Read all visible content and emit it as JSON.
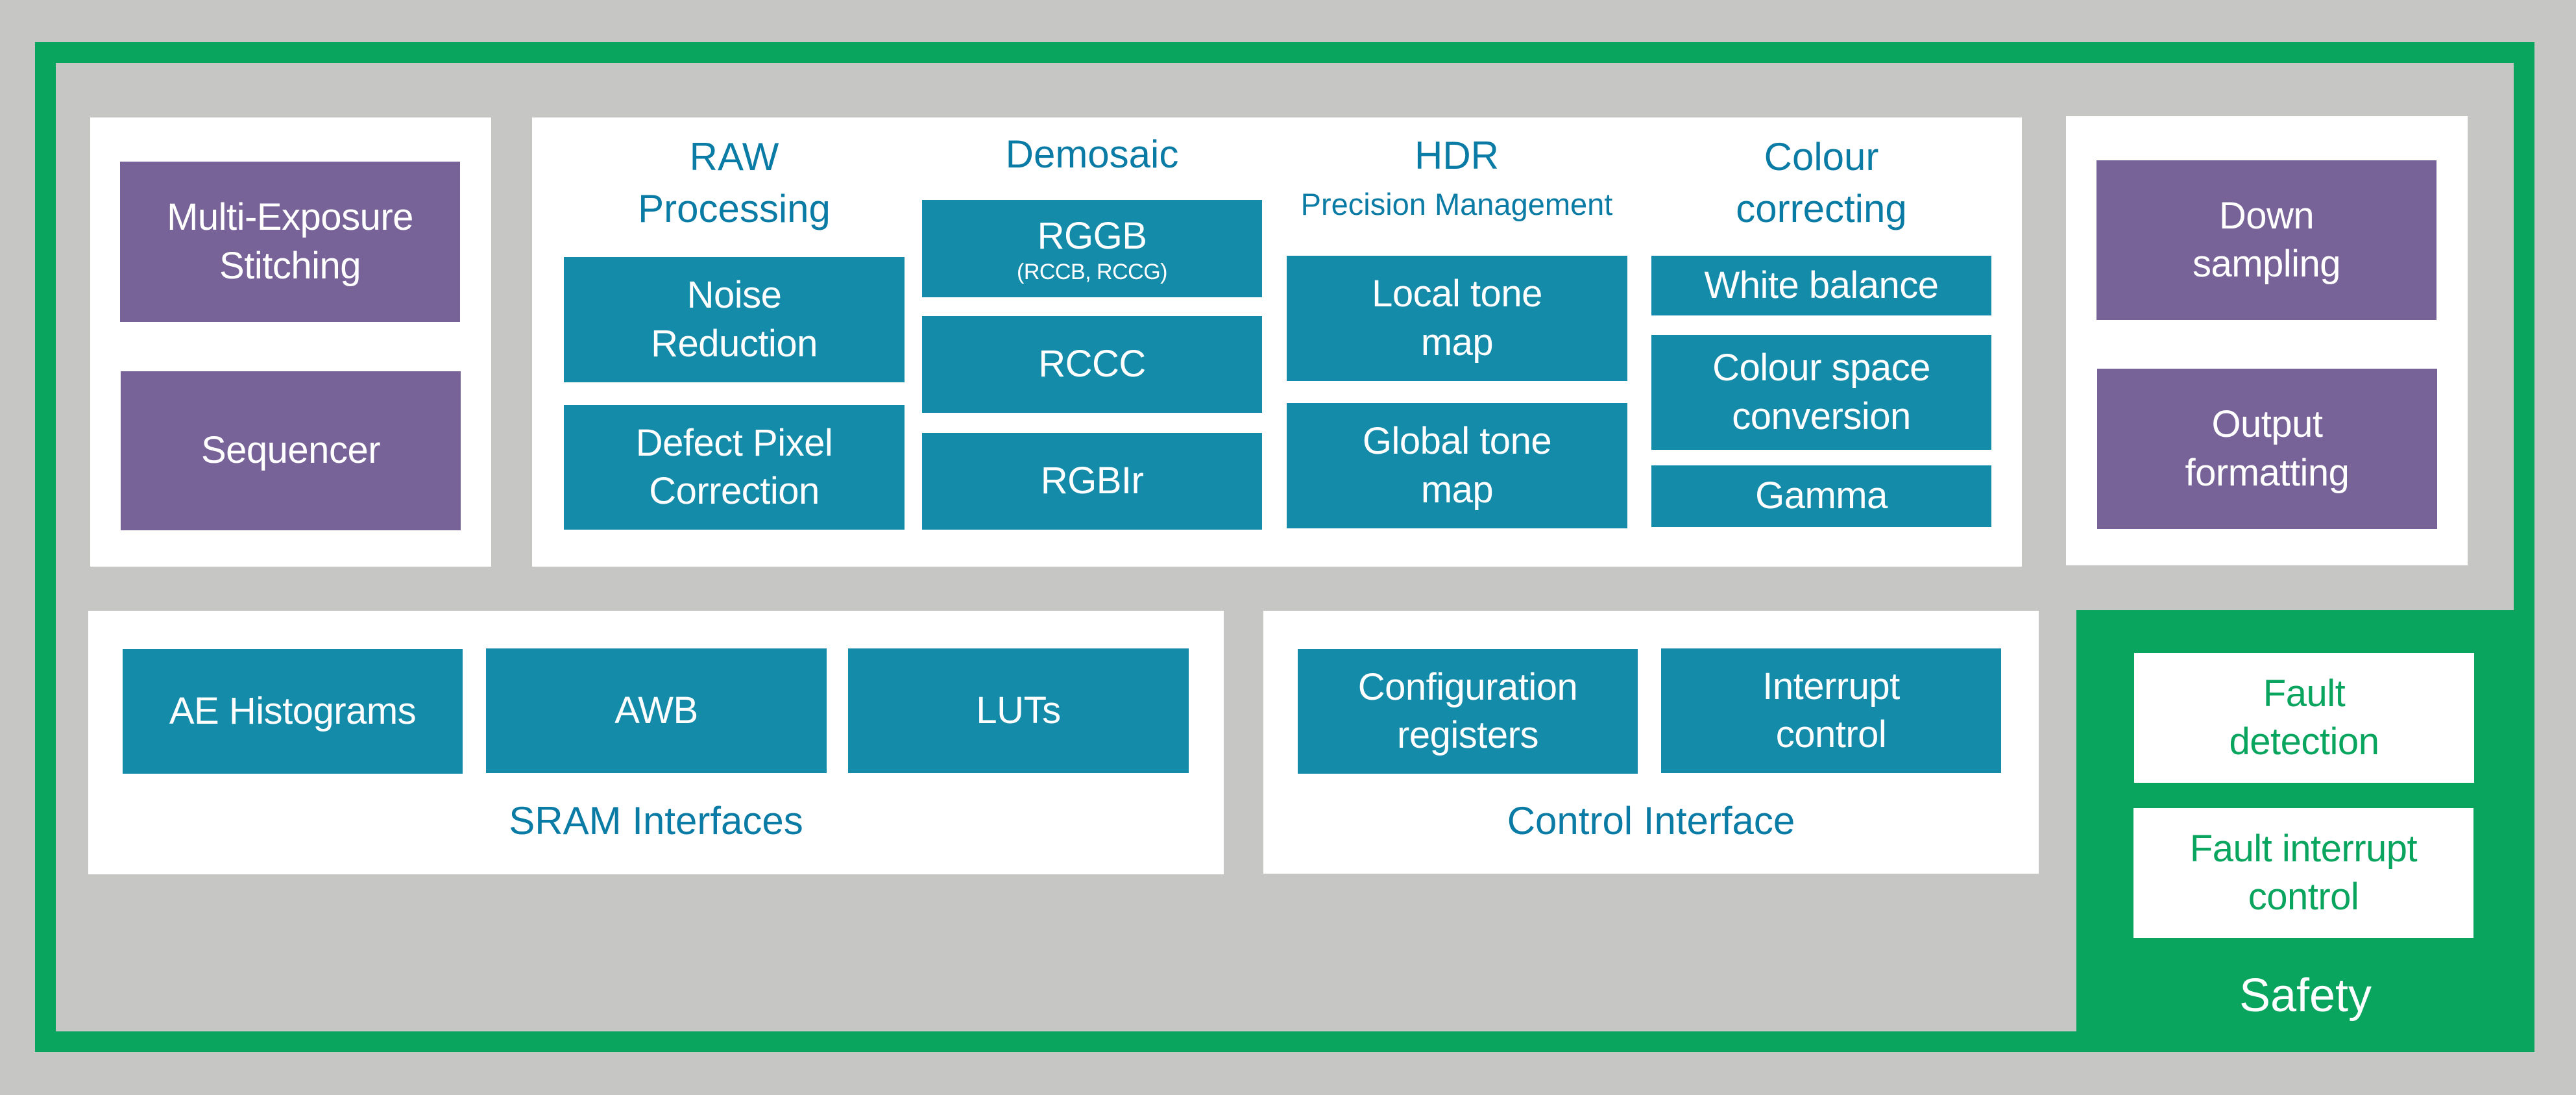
{
  "colors": {
    "background": "#C6C6C4",
    "safety_green": "#09A55F",
    "pipeline_purple": "#776397",
    "module_teal": "#158BAA",
    "heading_blue": "#0A7BA4"
  },
  "input_stage": {
    "blocks": [
      {
        "line1": "Multi-Exposure",
        "line2": "Stitching"
      },
      {
        "line1": "Sequencer",
        "line2": ""
      }
    ]
  },
  "processing": {
    "raw": {
      "title": "RAW",
      "subtitle": "Processing",
      "blocks": [
        {
          "line1": "Noise",
          "line2": "Reduction"
        },
        {
          "line1": "Defect Pixel",
          "line2": "Correction"
        }
      ]
    },
    "demosaic": {
      "title": "Demosaic",
      "blocks": [
        {
          "line1": "RGGB",
          "sub": "(RCCB, RCCG)"
        },
        {
          "line1": "RCCC"
        },
        {
          "line1": "RGBIr"
        }
      ]
    },
    "hdr": {
      "title": "HDR",
      "subtitle": "Precision Management",
      "blocks": [
        {
          "line1": "Local tone",
          "line2": "map"
        },
        {
          "line1": "Global tone",
          "line2": "map"
        }
      ]
    },
    "colour": {
      "title": "Colour",
      "subtitle": "correcting",
      "blocks": [
        {
          "line1": "White balance"
        },
        {
          "line1": "Colour space",
          "line2": "conversion"
        },
        {
          "line1": "Gamma"
        }
      ]
    }
  },
  "output_stage": {
    "blocks": [
      {
        "line1": "Down",
        "line2": "sampling"
      },
      {
        "line1": "Output",
        "line2": "formatting"
      }
    ]
  },
  "sram_interfaces": {
    "label": "SRAM Interfaces",
    "blocks": [
      {
        "line1": "AE Histograms"
      },
      {
        "line1": "AWB"
      },
      {
        "line1": "LUTs"
      }
    ]
  },
  "control_interface": {
    "label": "Control Interface",
    "blocks": [
      {
        "line1": "Configuration",
        "line2": "registers"
      },
      {
        "line1": "Interrupt",
        "line2": "control"
      }
    ]
  },
  "safety": {
    "label": "Safety",
    "blocks": [
      {
        "line1": "Fault",
        "line2": "detection"
      },
      {
        "line1": "Fault interrupt",
        "line2": "control"
      }
    ]
  }
}
